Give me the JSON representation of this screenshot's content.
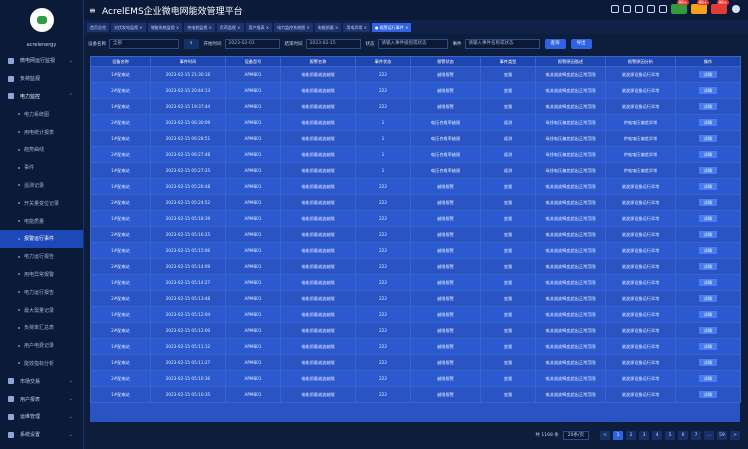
{
  "app": {
    "title": "AcrelEMS企业微电网能效管理平台",
    "user": "acrelenergy"
  },
  "colors": {
    "accent": "#2f62e4",
    "sidebar": "#0b1a38",
    "table_bg": "#2a54c4",
    "badge_red": "#e53935",
    "badge_green": "#2e9e3c",
    "badge_orange": "#f3a11b"
  },
  "top_icons": [
    "search-icon",
    "settings-icon",
    "fullscreen-icon",
    "mail-icon",
    "notification-icon"
  ],
  "badges": [
    {
      "count": "99+",
      "color": "#2e9e3c"
    },
    {
      "count": "99+",
      "color": "#f3a11b"
    },
    {
      "count": "99+",
      "color": "#e53935"
    }
  ],
  "sidebar": {
    "items": [
      {
        "label": "微电网运行监视",
        "icon": "home-icon",
        "type": "group",
        "chev": "⌄"
      },
      {
        "label": "负荷监视",
        "icon": "monitor-icon",
        "type": "group",
        "chev": ""
      },
      {
        "label": "电力监控",
        "icon": "power-icon",
        "type": "group-open",
        "chev": "⌃"
      },
      {
        "label": "电力系统图",
        "type": "sub"
      },
      {
        "label": "用电统计报表",
        "type": "sub"
      },
      {
        "label": "趋势曲线",
        "type": "sub"
      },
      {
        "label": "事件",
        "type": "sub"
      },
      {
        "label": "遥测记录",
        "type": "sub"
      },
      {
        "label": "开关量变位记录",
        "type": "sub"
      },
      {
        "label": "电能质量",
        "type": "sub"
      },
      {
        "label": "报警运行事件",
        "type": "sub-active"
      },
      {
        "label": "电力运行报告",
        "type": "sub"
      },
      {
        "label": "用电异常报警",
        "type": "sub"
      },
      {
        "label": "电力运行报告",
        "type": "sub"
      },
      {
        "label": "最大需量记录",
        "type": "sub"
      },
      {
        "label": "负荷率汇总表",
        "type": "sub"
      },
      {
        "label": "用户电费记录",
        "type": "sub"
      },
      {
        "label": "能效指标分析",
        "type": "sub"
      },
      {
        "label": "市场交易",
        "icon": "chart-icon",
        "type": "group",
        "chev": "⌄"
      },
      {
        "label": "用户报表",
        "icon": "report-icon",
        "type": "group",
        "chev": "⌄"
      },
      {
        "label": "运维管理",
        "icon": "tool-icon",
        "type": "group",
        "chev": "⌄"
      },
      {
        "label": "系统设置",
        "icon": "gear-icon",
        "type": "group",
        "chev": "⌄"
      }
    ]
  },
  "tabs": [
    {
      "label": "首页总览",
      "active": false
    },
    {
      "label": "光伏发电监视 ×",
      "active": false
    },
    {
      "label": "储能系统监视 ×",
      "active": false
    },
    {
      "label": "充电桩监视 ×",
      "active": false
    },
    {
      "label": "负荷监视 ×",
      "active": false
    },
    {
      "label": "用户报表 ×",
      "active": false
    },
    {
      "label": "电力监控系统图 ×",
      "active": false
    },
    {
      "label": "电能质量 ×",
      "active": false
    },
    {
      "label": "用电异常 ×",
      "active": false
    },
    {
      "label": "● 报警运行事件 ×",
      "active": true
    }
  ],
  "filter": {
    "device_label": "设备名称",
    "device_value": "全部",
    "start_label": "开始时间",
    "start_value": "2023-02-01",
    "end_label": "结束时间",
    "end_value": "2023-02-15",
    "level_label": "状态",
    "level_placeholder": "请输入事件级别或状态",
    "event_label": "事件",
    "event_placeholder": "请输入事件名称或状态",
    "query_button": "查询",
    "export_button": "导出"
  },
  "table": {
    "headers": [
      "设备名称",
      "事件时间",
      "设备型号",
      "报警名称",
      "事件状态",
      "报警状态",
      "事件类型",
      "报警原因描述",
      "报警原因分析",
      "操作"
    ],
    "rows": [
      [
        "1#配电站",
        "2023-02-15 21:30:16",
        "APM801",
        "电能质量谐波越限",
        "222",
        "越限报警",
        "变量",
        "电流谐波畸变超出正常范围",
        "谐波源设备运行异常",
        "详情"
      ],
      [
        "2#配电站",
        "2023-02-15 20:44:13",
        "APM801",
        "电能质量谐波越限",
        "222",
        "越限报警",
        "变量",
        "电流谐波畸变超出正常范围",
        "谐波源设备运行异常",
        "详情"
      ],
      [
        "1#配电站",
        "2023-02-15 19:37:44",
        "APM801",
        "电能质量谐波越限",
        "222",
        "越限报警",
        "变量",
        "电流谐波畸变超出正常范围",
        "谐波源设备运行异常",
        "详情"
      ],
      [
        "2#配电站",
        "2023-02-15 06:30:09",
        "APM801",
        "电能质量谐波越限",
        "1",
        "电压合格率越限",
        "遥测",
        "母线电压偏差超出正常范围",
        "供电电压偏差异常",
        "详情"
      ],
      [
        "1#配电站",
        "2023-02-15 06:28:51",
        "APM801",
        "电能质量谐波越限",
        "1",
        "电压合格率越限",
        "遥测",
        "母线电压偏差超出正常范围",
        "供电电压偏差异常",
        "详情"
      ],
      [
        "2#配电站",
        "2023-02-15 06:27:48",
        "APM801",
        "电能质量谐波越限",
        "1",
        "电压合格率越限",
        "遥测",
        "母线电压偏差超出正常范围",
        "供电电压偏差异常",
        "详情"
      ],
      [
        "1#配电站",
        "2023-02-15 05:27:25",
        "APM801",
        "电能质量谐波越限",
        "1",
        "电压合格率越限",
        "遥测",
        "母线电压偏差超出正常范围",
        "供电电压偏差异常",
        "详情"
      ],
      [
        "1#配电站",
        "2023-02-15 05:26:48",
        "APM801",
        "电能质量谐波越限",
        "222",
        "越限报警",
        "变量",
        "电流谐波畸变超出正常范围",
        "谐波源设备运行异常",
        "详情"
      ],
      [
        "2#配电站",
        "2023-02-15 05:24:52",
        "APM801",
        "电能质量谐波越限",
        "222",
        "越限报警",
        "变量",
        "电流谐波畸变超出正常范围",
        "谐波源设备运行异常",
        "详情"
      ],
      [
        "1#配电站",
        "2023-02-15 05:18:39",
        "APM801",
        "电能质量谐波越限",
        "222",
        "越限报警",
        "变量",
        "电流谐波畸变超出正常范围",
        "谐波源设备运行异常",
        "详情"
      ],
      [
        "2#配电站",
        "2023-02-15 05:16:25",
        "APM801",
        "电能质量谐波越限",
        "222",
        "越限报警",
        "变量",
        "电流谐波畸变超出正常范围",
        "谐波源设备运行异常",
        "详情"
      ],
      [
        "1#配电站",
        "2023-02-15 05:15:06",
        "APM801",
        "电能质量谐波越限",
        "222",
        "越限报警",
        "变量",
        "电流谐波畸变超出正常范围",
        "谐波源设备运行异常",
        "详情"
      ],
      [
        "2#配电站",
        "2023-02-15 05:14:09",
        "APM801",
        "电能质量谐波越限",
        "222",
        "越限报警",
        "变量",
        "电流谐波畸变超出正常范围",
        "谐波源设备运行异常",
        "详情"
      ],
      [
        "1#配电站",
        "2023-02-15 05:14:27",
        "APM801",
        "电能质量谐波越限",
        "222",
        "越限报警",
        "变量",
        "电流谐波畸变超出正常范围",
        "谐波源设备运行异常",
        "详情"
      ],
      [
        "2#配电站",
        "2023-02-15 05:13:48",
        "APM801",
        "电能质量谐波越限",
        "222",
        "越限报警",
        "变量",
        "电流谐波畸变超出正常范围",
        "谐波源设备运行异常",
        "详情"
      ],
      [
        "1#配电站",
        "2023-02-15 05:12:04",
        "APM801",
        "电能质量谐波越限",
        "222",
        "越限报警",
        "变量",
        "电流谐波畸变超出正常范围",
        "谐波源设备运行异常",
        "详情"
      ],
      [
        "2#配电站",
        "2023-02-15 05:12:00",
        "APM801",
        "电能质量谐波越限",
        "222",
        "越限报警",
        "变量",
        "电流谐波畸变超出正常范围",
        "谐波源设备运行异常",
        "详情"
      ],
      [
        "1#配电站",
        "2023-02-15 05:11:12",
        "APM801",
        "电能质量谐波越限",
        "222",
        "越限报警",
        "变量",
        "电流谐波畸变超出正常范围",
        "谐波源设备运行异常",
        "详情"
      ],
      [
        "1#配电站",
        "2023-02-15 05:11:27",
        "APM801",
        "电能质量谐波越限",
        "222",
        "越限报警",
        "变量",
        "电流谐波畸变超出正常范围",
        "谐波源设备运行异常",
        "详情"
      ],
      [
        "2#配电站",
        "2023-02-15 05:10:36",
        "APM801",
        "电能质量谐波越限",
        "222",
        "越限报警",
        "变量",
        "电流谐波畸变超出正常范围",
        "谐波源设备运行异常",
        "详情"
      ],
      [
        "1#配电站",
        "2023-02-15 05:10:35",
        "APM801",
        "电能质量谐波越限",
        "222",
        "越限报警",
        "变量",
        "电流谐波畸变超出正常范围",
        "谐波源设备运行异常",
        "详情"
      ]
    ]
  },
  "pager": {
    "total_text": "共 1168 条",
    "page_size": "20条/页",
    "pages": [
      "<",
      "1",
      "2",
      "3",
      "4",
      "5",
      "6",
      "7",
      "...",
      "59",
      ">"
    ],
    "active_page": "1"
  }
}
